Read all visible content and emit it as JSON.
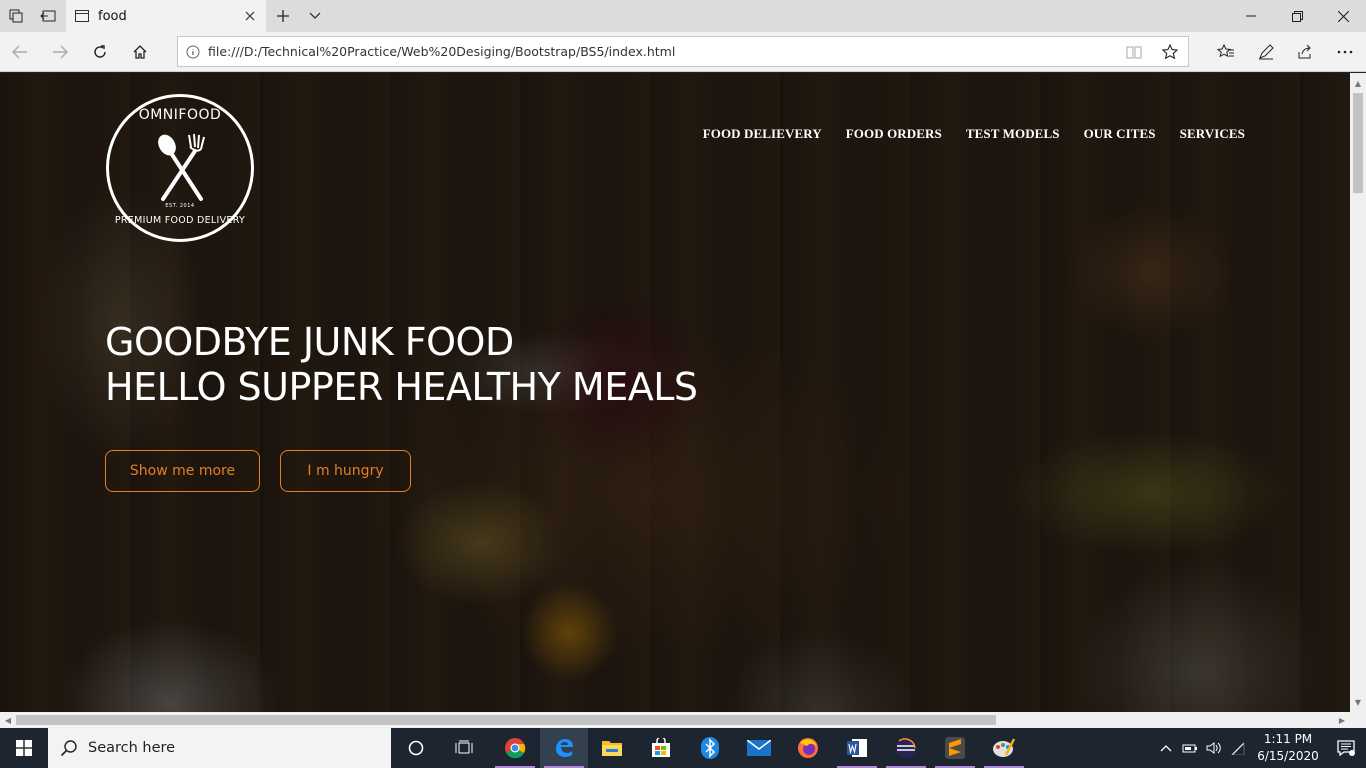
{
  "browser": {
    "tab_title": "food",
    "url": "file:///D:/Technical%20Practice/Web%20Desiging/Bootstrap/BS5/index.html"
  },
  "page": {
    "logo": {
      "brand": "OMNIFOOD",
      "est": "EST. 2014",
      "tagline": "PREMIUM FOOD DELIVERY"
    },
    "nav": [
      {
        "label": "FOOD DELIEVERY"
      },
      {
        "label": "FOOD ORDERS"
      },
      {
        "label": "TEST MODELS"
      },
      {
        "label": "OUR CITES"
      },
      {
        "label": "SERVICES"
      }
    ],
    "hero": {
      "line1": "GOODBYE JUNK FOOD",
      "line2": "HELLO SUPPER HEALTHY MEALS",
      "btn_more": "Show me more",
      "btn_hungry": "I m hungry"
    },
    "accent": "#e67e22"
  },
  "taskbar": {
    "search_placeholder": "Search here",
    "time": "1:11 PM",
    "date": "6/15/2020"
  }
}
